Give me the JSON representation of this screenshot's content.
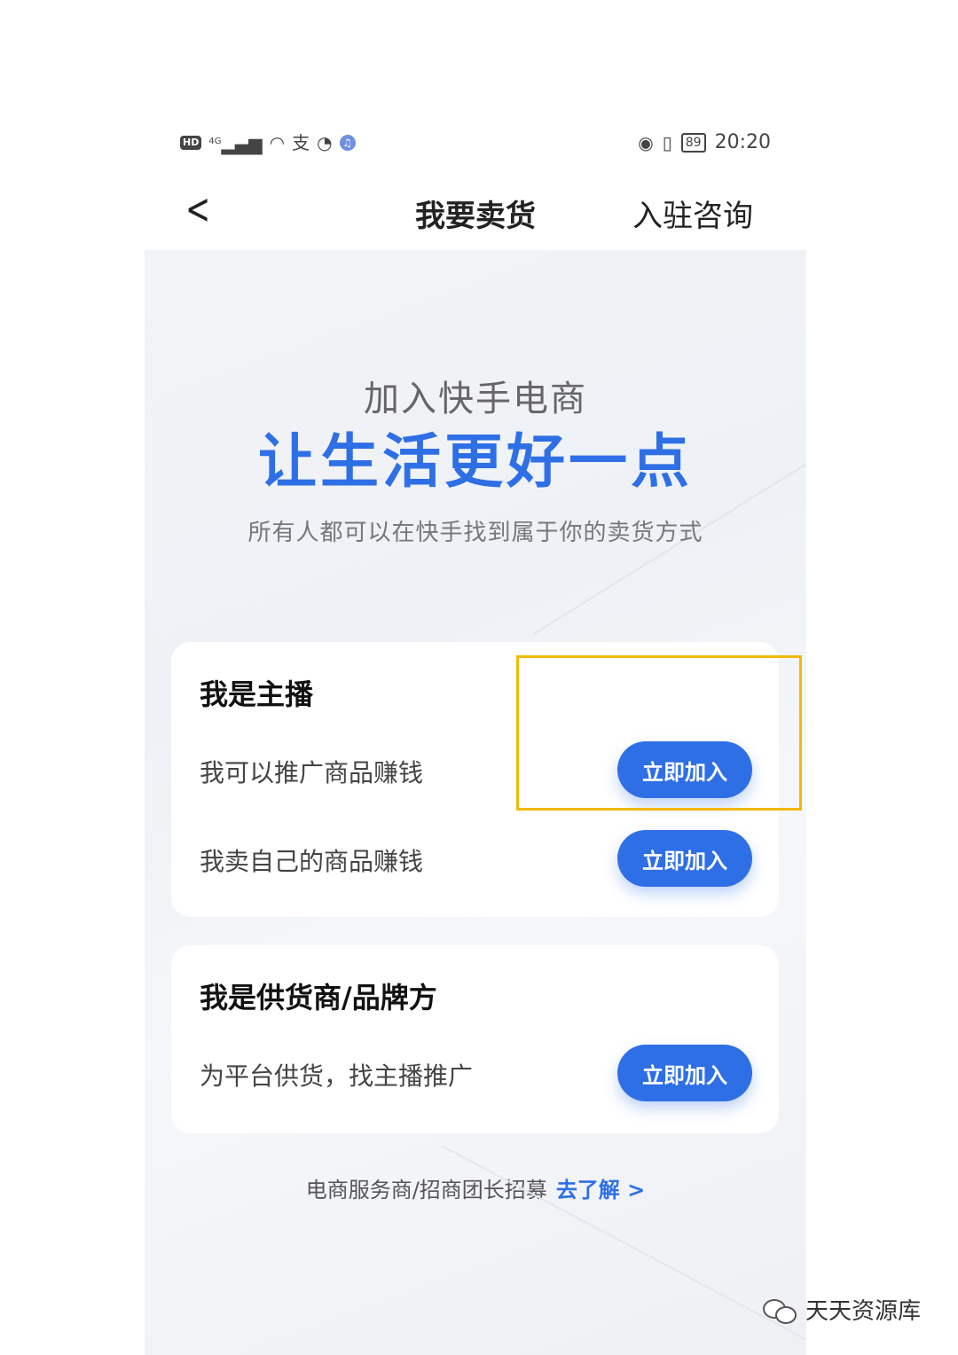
{
  "status_bar": {
    "left_badge": "HD",
    "network": "4G",
    "time": "20:20",
    "battery": "89"
  },
  "nav": {
    "title": "我要卖货",
    "right_action": "入驻咨询"
  },
  "hero": {
    "subtitle": "加入快手电商",
    "headline": "让生活更好一点",
    "tagline": "所有人都可以在快手找到属于你的卖货方式"
  },
  "cards": [
    {
      "title": "我是主播",
      "rows": [
        {
          "text": "我可以推广商品赚钱",
          "button": "立即加入"
        },
        {
          "text": "我卖自己的商品赚钱",
          "button": "立即加入"
        }
      ]
    },
    {
      "title": "我是供货商/品牌方",
      "rows": [
        {
          "text": "为平台供货，找主播推广",
          "button": "立即加入"
        }
      ]
    }
  ],
  "footer": {
    "text": "电商服务商/招商团长招募",
    "link": "去了解"
  },
  "watermark": "天天资源库",
  "colors": {
    "accent": "#2f6fe6",
    "highlight_box": "#f2b807"
  }
}
